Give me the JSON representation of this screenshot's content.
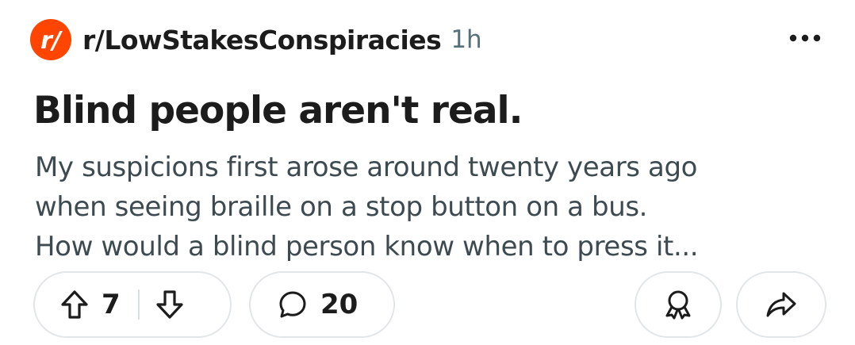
{
  "subreddit": {
    "name": "r/LowStakesConspiracies",
    "avatar_glyph": "r/",
    "avatar_color": "#ff4500"
  },
  "post": {
    "age": "1h",
    "more_label": "...",
    "title": "Blind people aren't real.",
    "body_lines": [
      "My suspicions first arose around twenty years ago",
      "when seeing braille on a stop button on a bus.",
      "How would a blind person know when to press it..."
    ]
  },
  "actions": {
    "score": "7",
    "comment_count": "20",
    "icons": {
      "upvote": "upvote-arrow-icon",
      "downvote": "downvote-arrow-icon",
      "comment": "comment-bubble-icon",
      "award": "award-icon",
      "share": "share-arrow-icon"
    },
    "border_color": "#e3e6e8"
  }
}
